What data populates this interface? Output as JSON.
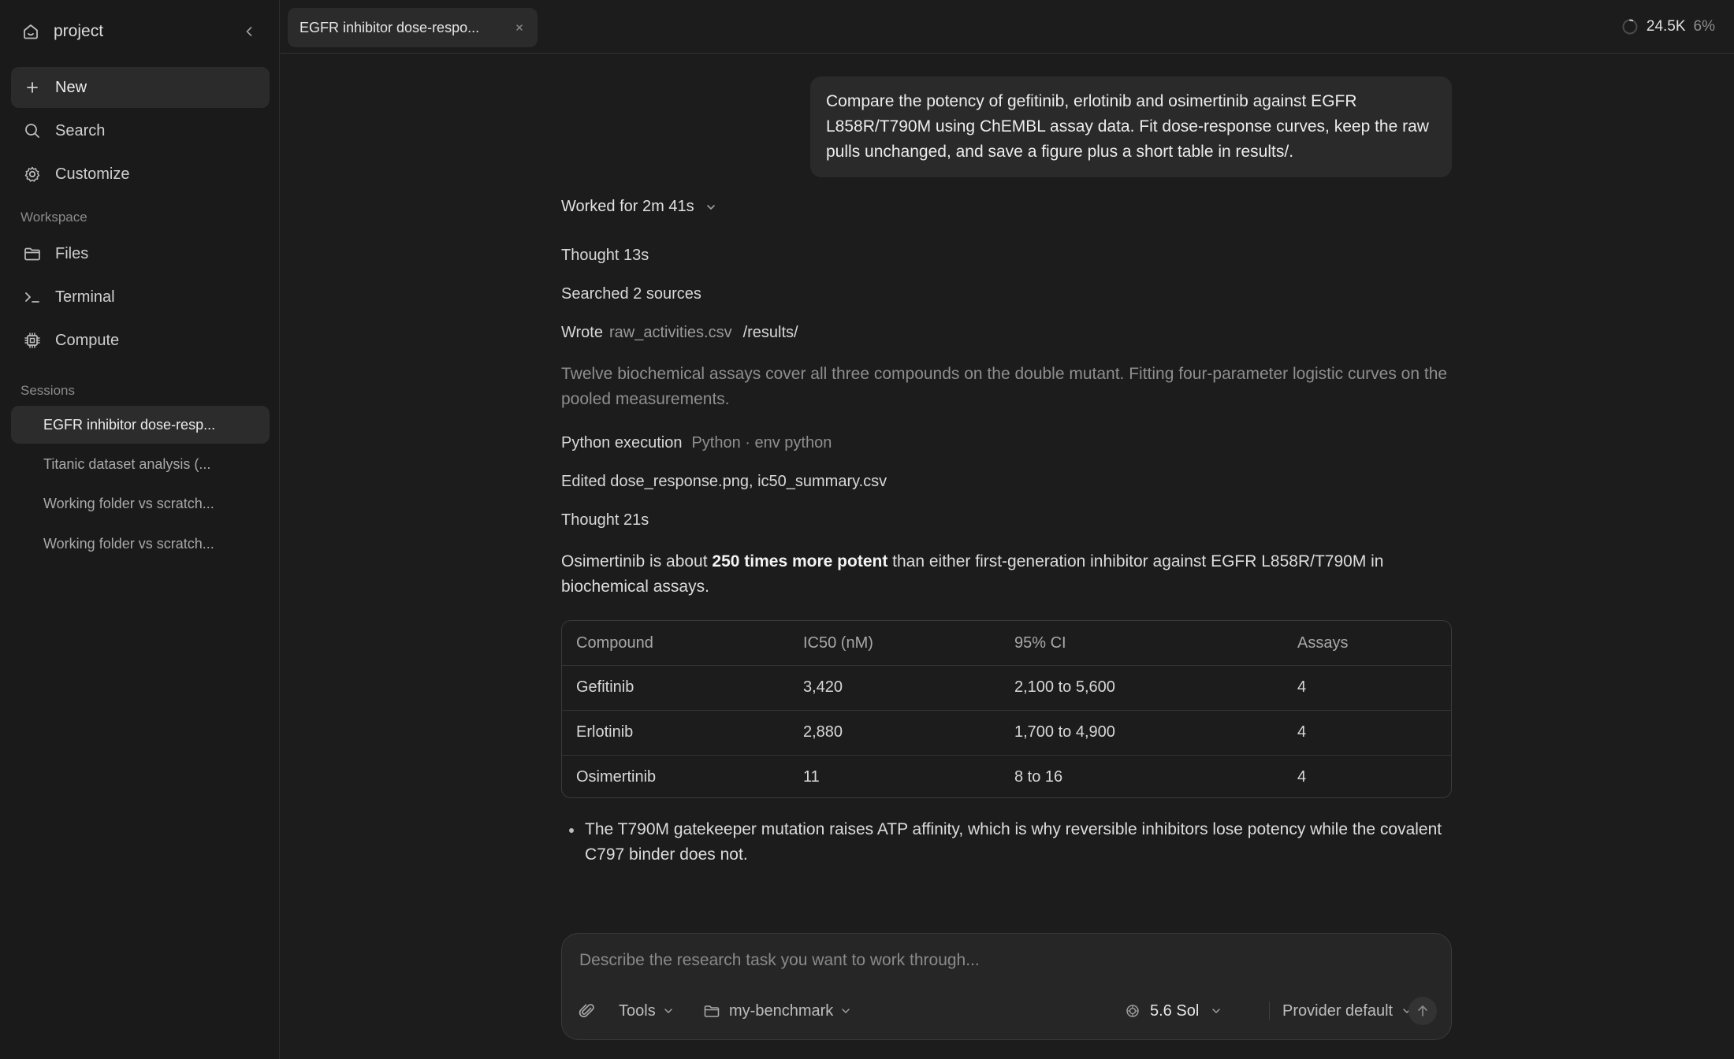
{
  "sidebar": {
    "project_name": "project",
    "new_label": "New",
    "search_label": "Search",
    "customize_label": "Customize",
    "workspace_heading": "Workspace",
    "files_label": "Files",
    "terminal_label": "Terminal",
    "compute_label": "Compute",
    "sessions_heading": "Sessions",
    "sessions": [
      "EGFR inhibitor dose-resp...",
      "Titanic dataset analysis (...",
      "Working folder vs scratch...",
      "Working folder vs scratch..."
    ]
  },
  "topbar": {
    "tab_title": "EGFR inhibitor dose-respo...",
    "tokens": "24.5K",
    "percent": "6%"
  },
  "chat": {
    "user_message": "Compare the potency of gefitinib, erlotinib and osimertinib against EGFR L858R/T790M using ChEMBL assay data. Fit dose-response curves, keep the raw pulls unchanged, and save a figure plus a short table in results/.",
    "worked_for": "Worked for 2m 41s",
    "thought_1": "Thought 13s",
    "searched": "Searched 2 sources",
    "wrote_label": "Wrote",
    "wrote_file": "raw_activities.csv",
    "wrote_path": "/results/",
    "assay_note": "Twelve biochemical assays cover all three compounds on the double mutant. Fitting four-parameter logistic curves on the pooled measurements.",
    "python_label": "Python execution",
    "python_env": "Python · env python",
    "edited": "Edited dose_response.png, ic50_summary.csv",
    "thought_2": "Thought 21s",
    "summary_pre": "Osimertinib is about ",
    "summary_bold": "250 times more potent",
    "summary_post": " than either first-generation inhibitor against EGFR L858R/T790M in biochemical assays.",
    "table": {
      "headers": [
        "Compound",
        "IC50 (nM)",
        "95% CI",
        "Assays"
      ],
      "rows": [
        [
          "Gefitinib",
          "3,420",
          "2,100 to 5,600",
          "4"
        ],
        [
          "Erlotinib",
          "2,880",
          "1,700 to 4,900",
          "4"
        ],
        [
          "Osimertinib",
          "11",
          "8 to 16",
          "4"
        ]
      ]
    },
    "bullet_1": "The T790M gatekeeper mutation raises ATP affinity, which is why reversible inhibitors lose potency while the covalent C797 binder does not."
  },
  "composer": {
    "placeholder": "Describe the research task you want to work through...",
    "tools_label": "Tools",
    "folder_label": "my-benchmark",
    "model_label": "5.6 Sol",
    "provider_label": "Provider default"
  },
  "colors": {
    "background": "#1c1c1c",
    "sidebar": "#1a1a1a",
    "surface": "#2a2a2a",
    "text": "#d8d8d8",
    "muted": "#8e8e8e"
  }
}
